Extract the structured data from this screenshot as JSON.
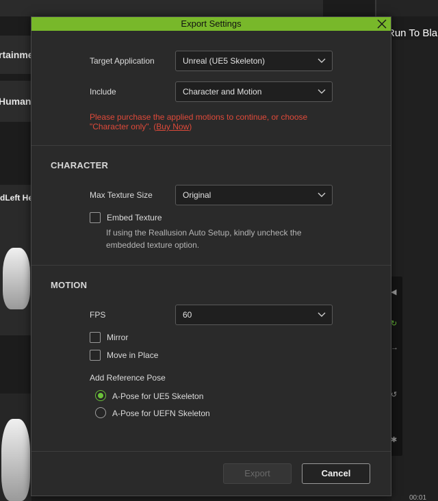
{
  "background": {
    "card1_text": "rtainme",
    "card2_text": "Human",
    "panel_label": "dLeft He",
    "right_title": "Run To Bla",
    "time_text": "00:01"
  },
  "dialog": {
    "title": "Export Settings",
    "target_application": {
      "label": "Target Application",
      "value": "Unreal (UE5 Skeleton)"
    },
    "include": {
      "label": "Include",
      "value": "Character and Motion"
    },
    "warning": {
      "text": "Please purchase the applied motions to continue, or choose \"Character only\". (",
      "link": "Buy Now",
      "suffix": ")"
    },
    "character": {
      "section_title": "CHARACTER",
      "max_texture_size": {
        "label": "Max Texture Size",
        "value": "Original"
      },
      "embed_texture": {
        "label": "Embed Texture",
        "checked": false
      },
      "hint": "If using the Reallusion Auto Setup, kindly uncheck the embedded texture option."
    },
    "motion": {
      "section_title": "MOTION",
      "fps": {
        "label": "FPS",
        "value": "60"
      },
      "mirror": {
        "label": "Mirror",
        "checked": false
      },
      "move_in_place": {
        "label": "Move in Place",
        "checked": false
      },
      "reference_pose": {
        "label": "Add Reference Pose",
        "options": [
          {
            "label": "A-Pose for UE5 Skeleton",
            "selected": true
          },
          {
            "label": "A-Pose for UEFN Skeleton",
            "selected": false
          }
        ]
      }
    },
    "buttons": {
      "export": "Export",
      "cancel": "Cancel"
    }
  },
  "colors": {
    "accent": "#78b82a",
    "warning": "#e04a3a",
    "radio_selected": "#6cc23a"
  }
}
